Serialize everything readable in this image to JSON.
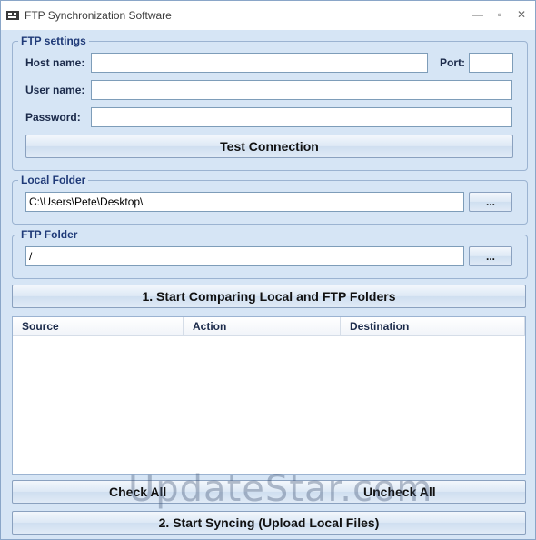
{
  "window": {
    "title": "FTP Synchronization Software",
    "controls": {
      "minimize": "—",
      "maximize": "▫",
      "close": "✕"
    }
  },
  "ftp_settings": {
    "legend": "FTP settings",
    "host_label": "Host name:",
    "host_value": "",
    "port_label": "Port:",
    "port_value": "",
    "user_label": "User name:",
    "user_value": "",
    "password_label": "Password:",
    "password_value": "",
    "test_button": "Test Connection"
  },
  "local_folder": {
    "legend": "Local Folder",
    "path": "C:\\Users\\Pete\\Desktop\\",
    "browse_label": "..."
  },
  "ftp_folder": {
    "legend": "FTP Folder",
    "path": "/",
    "browse_label": "..."
  },
  "actions": {
    "compare_button": "1. Start Comparing Local and FTP Folders",
    "check_all": "Check All",
    "uncheck_all": "Uncheck All",
    "sync_button": "2. Start Syncing (Upload Local Files)"
  },
  "list": {
    "columns": [
      "Source",
      "Action",
      "Destination"
    ]
  },
  "watermark": "UpdateStar.com"
}
